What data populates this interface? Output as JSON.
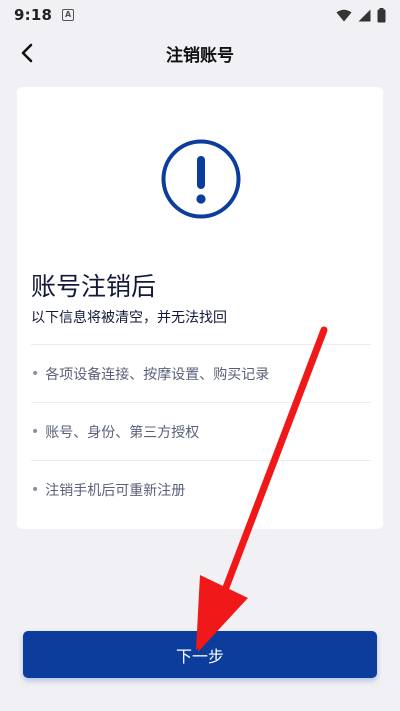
{
  "status_bar": {
    "time": "9:18",
    "app_icon_letter": "A"
  },
  "nav": {
    "title": "注销账号",
    "back_icon": "chevron-left-icon"
  },
  "card": {
    "icon": "exclamation-circle-icon",
    "icon_color": "#0c3c9c",
    "heading": "账号注销后",
    "subheading": "以下信息将被清空，并无法找回",
    "items": [
      "各项设备连接、按摩设置、购买记录",
      "账号、身份、第三方授权",
      "注销手机后可重新注册"
    ]
  },
  "actions": {
    "next_label": "下一步",
    "primary_color": "#0c3c9c"
  },
  "annotation": {
    "arrow_color": "#f01818"
  }
}
